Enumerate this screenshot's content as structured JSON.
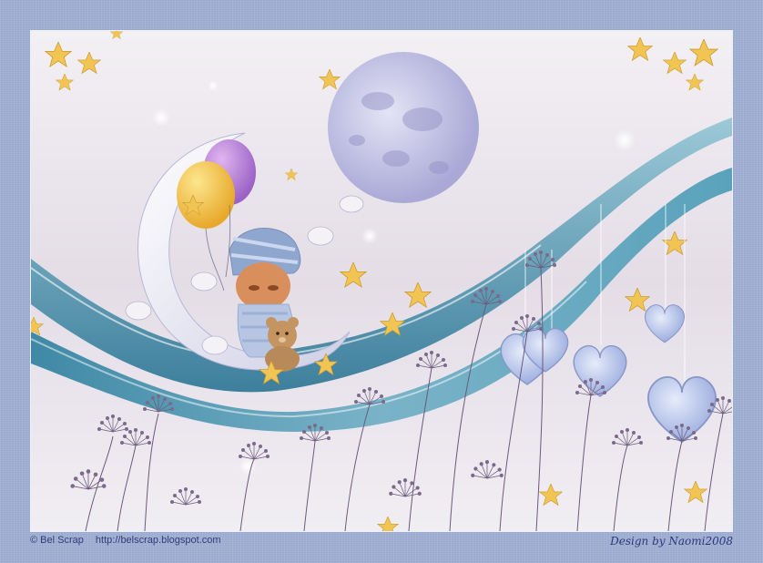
{
  "image": {
    "description_colors": {
      "frame": "#9fb0d6",
      "background": "#e8e4ec",
      "wave_teal": "#4f93ad",
      "moon": "#c9c8e6",
      "star": "#f2c453",
      "balloon_yellow": "#f3be3e",
      "balloon_purple": "#b784d4",
      "heart_blue": "#b7c3ea",
      "flowers": "#6b5a7c"
    }
  },
  "footer": {
    "copyright": "© Bel Scrap",
    "url": "http://belscrap.blogspot.com",
    "designer": "Design by Naomi2008"
  }
}
